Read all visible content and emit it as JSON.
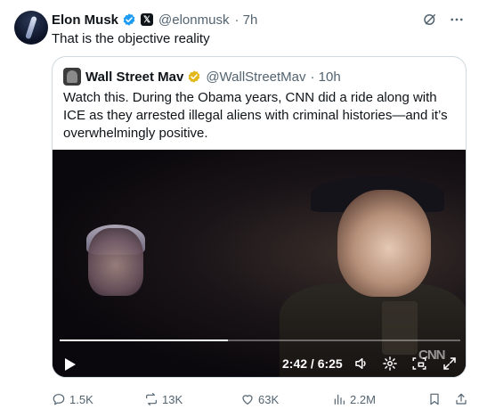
{
  "tweet": {
    "author_name": "Elon Musk",
    "author_handle": "@elonmusk",
    "time": "· 7h",
    "text": "That is the objective reality",
    "badge_x": "𝕏"
  },
  "quote": {
    "author_name": "Wall Street Mav",
    "author_handle": "@WallStreetMav",
    "time": "· 10h",
    "text": "Watch this. During the Obama years, CNN did a ride along with ICE as they arrested illegal aliens with criminal histories—and it’s overwhelmingly positive."
  },
  "video": {
    "current_time": "2:42",
    "duration": "6:25",
    "time_display": "2:42 / 6:25",
    "progress_fraction": 0.42,
    "watermark": "CNN"
  },
  "actions": {
    "replies": "1.5K",
    "reposts": "13K",
    "likes": "63K",
    "views": "2.2M"
  },
  "colors": {
    "verified_blue": "#1d9bf0",
    "verified_gold": "#e2b719",
    "muted": "#536471",
    "border": "#cfd9de"
  }
}
